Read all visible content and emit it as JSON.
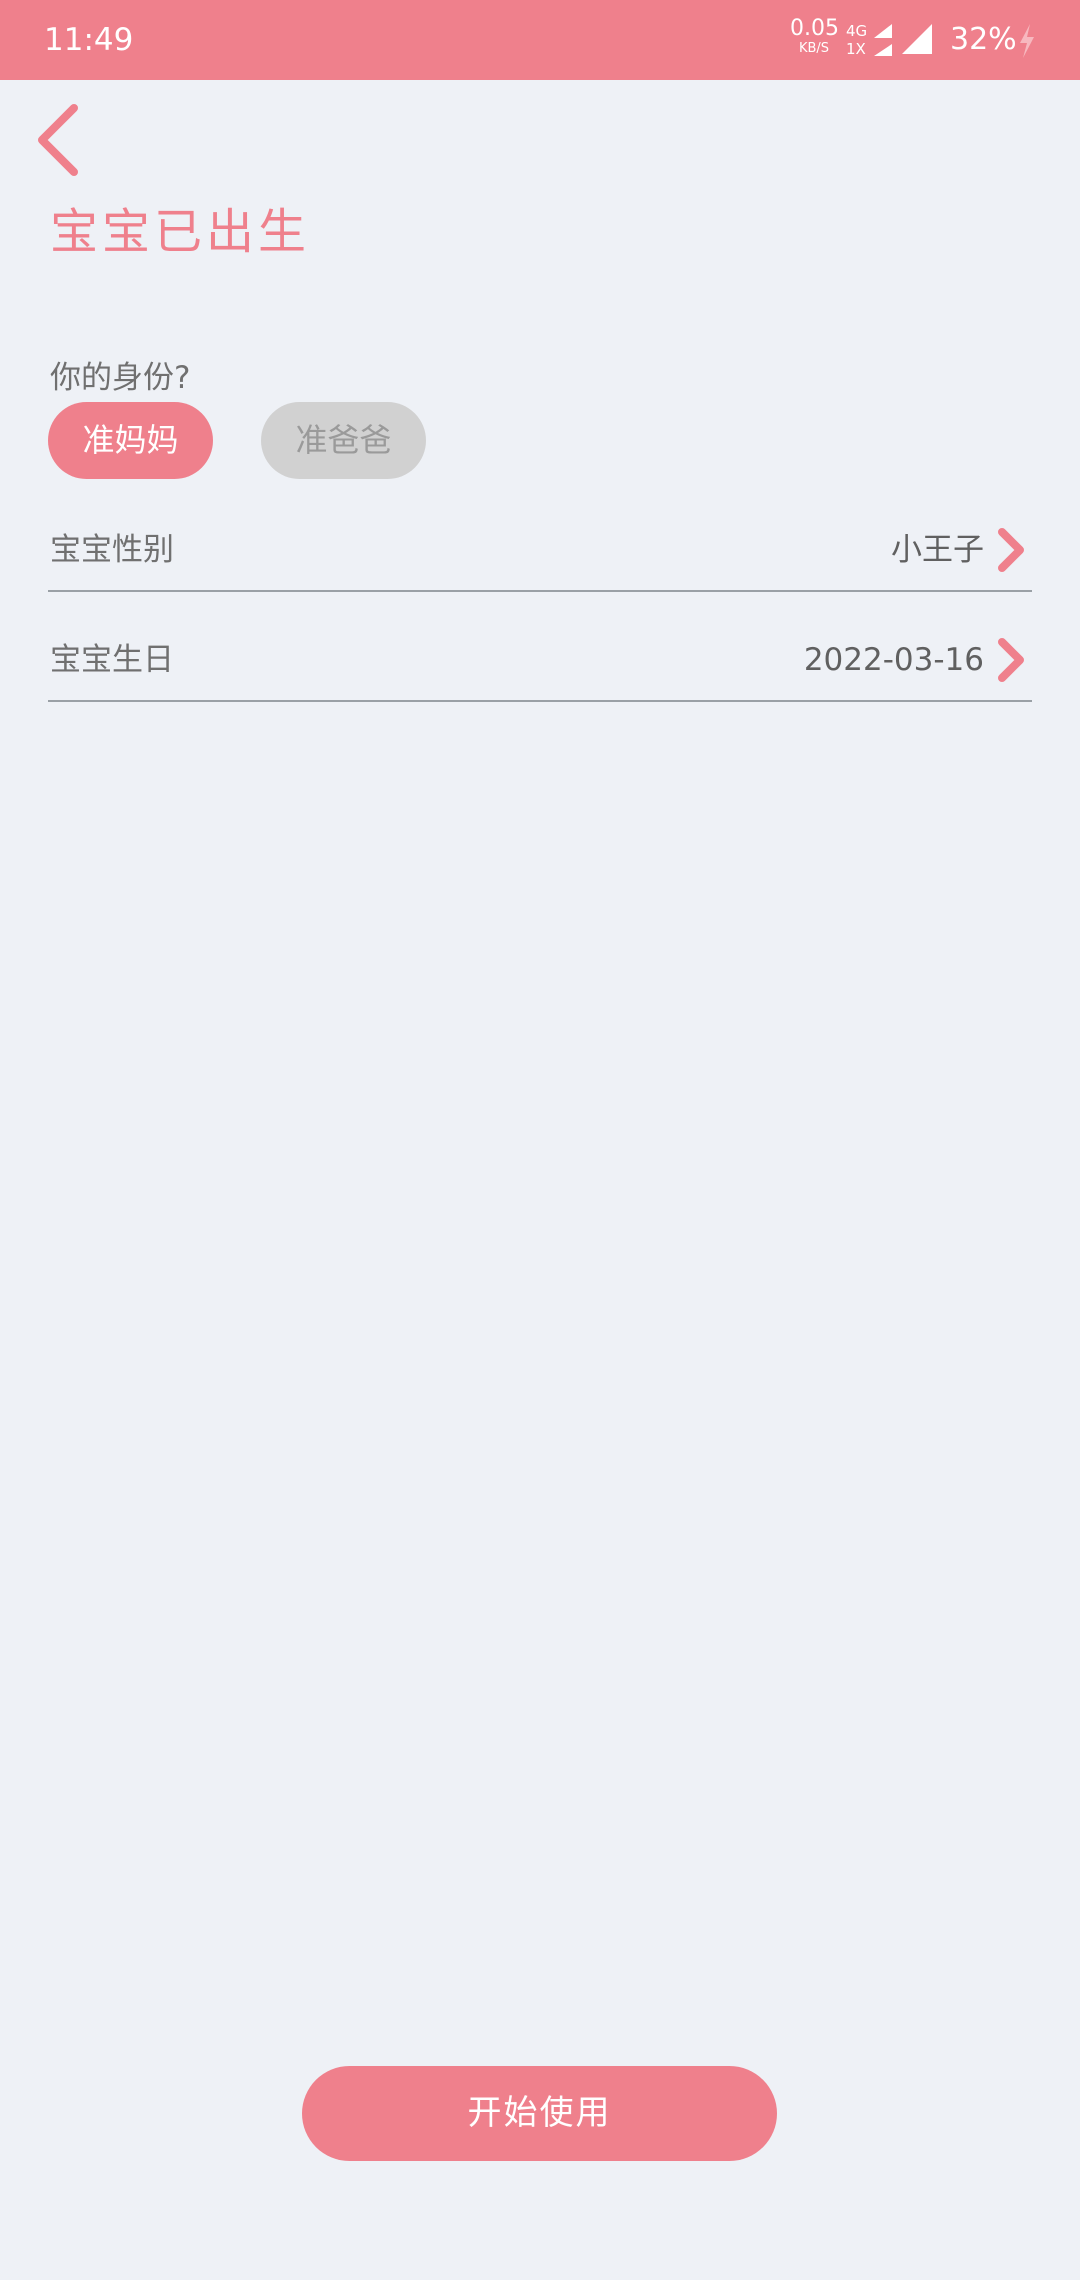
{
  "status_bar": {
    "time": "11:49",
    "net_speed_value": "0.05",
    "net_speed_unit": "KB/S",
    "net_type_top": "4G",
    "net_type_bottom": "1X",
    "battery_percent": "32%"
  },
  "header": {
    "back_icon": "chevron-left-icon",
    "title": "宝宝已出生"
  },
  "identity": {
    "label": "你的身份?",
    "options": [
      {
        "label": "准妈妈",
        "selected": true
      },
      {
        "label": "准爸爸",
        "selected": false
      }
    ]
  },
  "fields": {
    "gender": {
      "label": "宝宝性别",
      "value": "小王子"
    },
    "birthday": {
      "label": "宝宝生日",
      "value": "2022-03-16"
    }
  },
  "actions": {
    "start_label": "开始使用"
  },
  "colors": {
    "accent": "#ef808c",
    "background": "#eef1f6",
    "inactive_pill": "#d1d1d1"
  }
}
